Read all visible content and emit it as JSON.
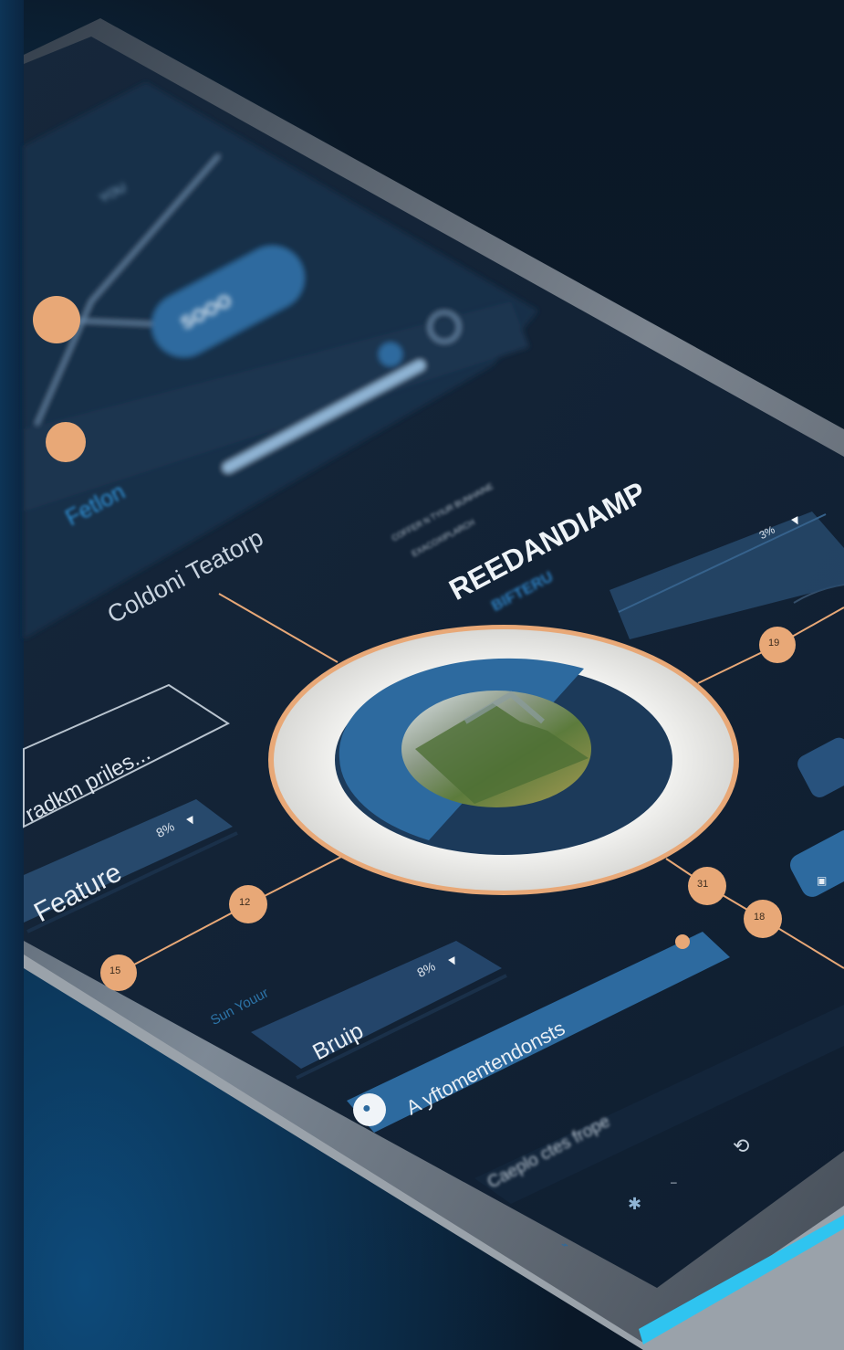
{
  "top_panel": {
    "tab_label": "Fetlon",
    "bubble_label": "SOOO",
    "top_label": "YOU"
  },
  "section": {
    "title": "Coldoni Teatorp",
    "search_text": "radkm priles..."
  },
  "hero": {
    "title": "REEDANDIAMP",
    "subtitle": "BIFTERU",
    "caption_line1": "COFFER N TYIUR BUNHAINE",
    "caption_line2": "EXACOXIPLARCH",
    "dropdown_value": "3%"
  },
  "cards": [
    {
      "label": "Feature",
      "value": "8%"
    },
    {
      "label": "Bruip",
      "value": "8%"
    }
  ],
  "list_caption": "Sun Youur",
  "action_bar": {
    "label": "A yftomentendonsts"
  },
  "footer_text": "Caeplo ctes frope",
  "nodes": [
    "19",
    "31",
    "18",
    "12",
    "15"
  ],
  "colors": {
    "accent": "#e8a877",
    "panel": "#132438",
    "blue": "#2d6a9f",
    "glow": "#2fc4f0"
  }
}
